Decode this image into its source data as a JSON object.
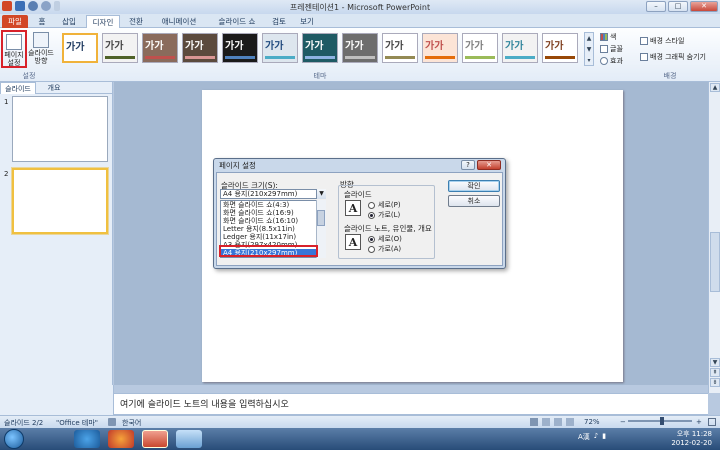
{
  "window": {
    "title": "프레젠테이션1 - Microsoft PowerPoint",
    "controls": {
      "minimize": "–",
      "maximize": "□",
      "close": "✕"
    }
  },
  "tabs": [
    "파일",
    "홈",
    "삽입",
    "디자인",
    "전환",
    "애니메이션",
    "슬라이드 쇼",
    "검토",
    "보기"
  ],
  "active_tab": "디자인",
  "ribbon": {
    "page_setup": {
      "label": "페이지\n설정"
    },
    "orientation": {
      "label": "슬라이드\n방향"
    },
    "group_setup": "설정",
    "group_theme": "테마",
    "group_background": "배경",
    "theme_label": "가가",
    "themes": [
      {
        "label": "가가",
        "bg": "#ffffff",
        "fg": "#1f3a60",
        "band": "#ffffff"
      },
      {
        "label": "가가",
        "bg": "#f2f2f2",
        "fg": "#444444",
        "band": "#4f6228"
      },
      {
        "label": "가가",
        "bg": "#8a6b5c",
        "fg": "#ffffff",
        "band": "#c0504d"
      },
      {
        "label": "가가",
        "bg": "#5b4a3d",
        "fg": "#ffffff",
        "band": "#d99694"
      },
      {
        "label": "가가",
        "bg": "#1a1a1a",
        "fg": "#ffffff",
        "band": "#4f81bd"
      },
      {
        "label": "가가",
        "bg": "#dde6ee",
        "fg": "#1f497d",
        "band": "#4bacc6"
      },
      {
        "label": "가가",
        "bg": "#1e5a64",
        "fg": "#ffffff",
        "band": "#8db3e2"
      },
      {
        "label": "가가",
        "bg": "#6d6d6d",
        "fg": "#ffffff",
        "band": "#bfbfbf"
      },
      {
        "label": "가가",
        "bg": "#ffffff",
        "fg": "#444444",
        "band": "#948a54"
      },
      {
        "label": "가가",
        "bg": "#fce4d6",
        "fg": "#c0504d",
        "band": "#e46c0a"
      },
      {
        "label": "가가",
        "bg": "#ffffff",
        "fg": "#7f7f7f",
        "band": "#9bbb59"
      },
      {
        "label": "가가",
        "bg": "#f2f2f2",
        "fg": "#31859c",
        "band": "#4bacc6"
      },
      {
        "label": "가가",
        "bg": "#ffffff",
        "fg": "#7f3f1f",
        "band": "#984807"
      }
    ],
    "side_items": {
      "colors": "색",
      "fonts": "글꼴",
      "effects": "효과"
    },
    "background_styles": "배경 스타일",
    "hide_background": "배경 그래픽 숨기기"
  },
  "left_pane": {
    "tabs": [
      "슬라이드",
      "개요"
    ],
    "slides": [
      "1",
      "2"
    ]
  },
  "notes": {
    "placeholder": "여기에 슬라이드 노트의 내용을 입력하십시오"
  },
  "status": {
    "slide": "슬라이드 2/2",
    "theme": "\"Office 테마\"",
    "language": "한국어",
    "zoom": "72%"
  },
  "clock": {
    "time": "오후 11:28",
    "date": "2012-02-20"
  },
  "tray": {
    "ime": "A漢"
  },
  "dialog": {
    "title": "페이지 설정",
    "help": "?",
    "close": "✕",
    "size_label": "슬라이드 크기(S):",
    "size_value": "A4 용지(210x297mm)",
    "size_options": [
      "화면 슬라이드 쇼(4:3)",
      "화면 슬라이드 쇼(16:9)",
      "화면 슬라이드 쇼(16:10)",
      "Letter 용지(8.5x11in)",
      "Ledger 용지(11x17in)",
      "A3 용지(297x420mm)",
      "A4 용지(210x297mm)"
    ],
    "selected_option": "A4 용지(210x297mm)",
    "orientation_label": "방향",
    "slides_label": "슬라이드",
    "notes_label": "슬라이드 노트, 유인물, 개요",
    "portrait": "세로(P)",
    "landscape": "가로(L)",
    "portrait2": "세로(O)",
    "landscape2": "가로(A)",
    "ok": "확인",
    "cancel": "취소",
    "page_glyph": "A"
  }
}
